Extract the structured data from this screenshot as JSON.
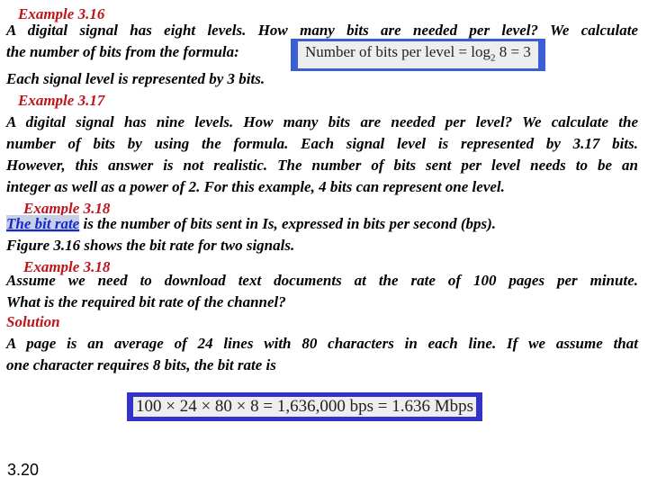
{
  "ex316": {
    "heading": "Example 3.16",
    "line1": "A digital signal has eight levels. How many bits are needed per level? We calculate",
    "line2": "the number of bits from the formula:",
    "formula_prefix": "Number of bits per level = log",
    "formula_sub": "2",
    "formula_suffix": " 8 = 3",
    "conclusion": "Each signal level is represented by 3 bits."
  },
  "ex317": {
    "heading": "Example 3.17",
    "lines": [
      "A digital signal has nine levels. How many bits are needed per level? We calculate the",
      "number of bits by using the formula. Each signal level is represented by 3.17 bits.",
      "However, this answer is not realistic. The number of bits sent per level needs to be an",
      "integer as well as a power of 2. For this example, 4 bits can represent one level."
    ]
  },
  "bitrate_def": {
    "heading": "Example 3.18",
    "link_text": "The bit rate",
    "rest": " is the number of bits sent in Is, expressed in bits per second (bps).",
    "figure_line": "Figure 3.16 shows the bit rate for two signals."
  },
  "ex318": {
    "heading": "Example 3.18",
    "line1": "Assume we need to download text documents at the rate of 100 pages per minute.",
    "line2": "What is the required bit rate of the channel?",
    "solution_label": "Solution",
    "sol_line1": "A page is an average of 24 lines with 80 characters in each line. If we assume that",
    "sol_line2": "one character requires 8 bits, the bit rate is",
    "formula": "100 × 24 × 80 × 8 = 1,636,000 bps = 1.636 Mbps"
  },
  "page_number": "3.20",
  "colors": {
    "heading": "#c0141a",
    "formula_border": "#3a5fd4",
    "formula_border_2": "#3333cc",
    "link": "#1428c8"
  }
}
